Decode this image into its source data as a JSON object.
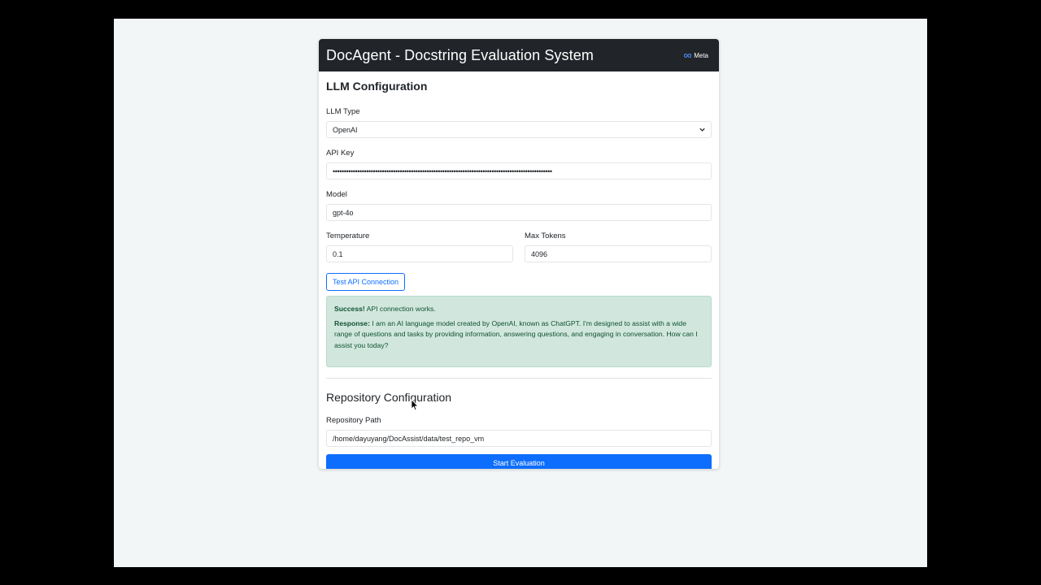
{
  "header": {
    "title": "DocAgent - Docstring Evaluation System",
    "brand": "Meta",
    "brand_icon": "meta-infinity-icon"
  },
  "llm_config": {
    "section_title": "LLM Configuration",
    "llm_type": {
      "label": "LLM Type",
      "value": "OpenAI",
      "icon": "chevron-down-icon"
    },
    "api_key": {
      "label": "API Key",
      "value": "••••••••••••••••••••••••••••••••••••••••••••••••••••••••••••••••••••••••••••••••••••••••••••••••••"
    },
    "model": {
      "label": "Model",
      "value": "gpt-4o"
    },
    "temperature": {
      "label": "Temperature",
      "value": "0.1"
    },
    "max_tokens": {
      "label": "Max Tokens",
      "value": "4096"
    },
    "test_button": "Test API Connection",
    "alert": {
      "success_label": "Success!",
      "success_text": "API connection works.",
      "response_label": "Response:",
      "response_text": "I am an AI language model created by OpenAI, known as ChatGPT. I'm designed to assist with a wide range of questions and tasks by providing information, answering questions, and engaging in conversation. How can I assist you today?"
    }
  },
  "repo_config": {
    "section_title": "Repository Configuration",
    "repo_path": {
      "label": "Repository Path",
      "value": "/home/dayuyang/DocAssist/data/test_repo_vm"
    },
    "start_button": "Start Evaluation"
  },
  "colors": {
    "header_bg": "#212529",
    "primary": "#0d6efd",
    "success_bg": "#d1e7dd",
    "success_text": "#0f5132"
  }
}
